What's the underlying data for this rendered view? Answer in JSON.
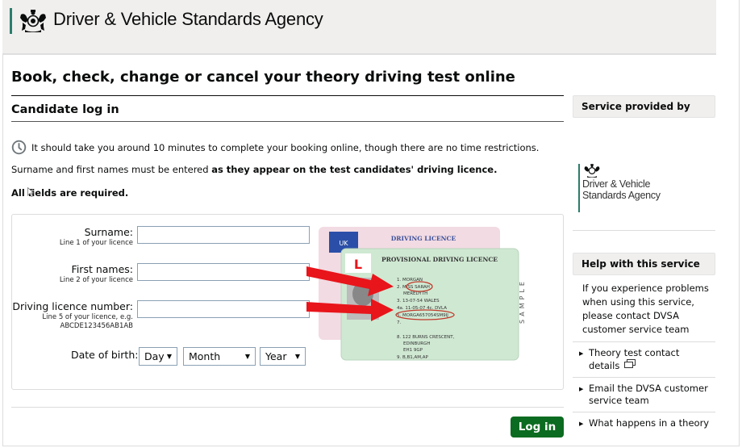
{
  "header": {
    "agency_name": "Driver & Vehicle Standards Agency",
    "brand_color": "#2b7d6a"
  },
  "main": {
    "page_title": "Book, check, change or cancel your theory driving test online",
    "section_title": "Candidate log in",
    "intro_icon": "clock-icon",
    "intro_text": "It should take you around 10 minutes to complete your booking online, though there are no time restrictions.",
    "note_prefix": "Surname and first names must be entered ",
    "note_bold": "as they appear on the test candidates' driving licence.",
    "required_text": "All fields are required."
  },
  "form": {
    "surname": {
      "label": "Surname:",
      "hint": "Line 1 of your licence",
      "value": ""
    },
    "first_names": {
      "label": "First names:",
      "hint": "Line 2 of your licence",
      "value": ""
    },
    "licence_number": {
      "label": "Driving licence number:",
      "hint": "Line 5 of your licence, e.g.",
      "example": "ABCDE123456AB1AB",
      "value": ""
    },
    "dob": {
      "label": "Date of birth:",
      "day": "Day",
      "month": "Month",
      "year": "Year"
    },
    "login_label": "Log in",
    "login_color": "#0b6b20"
  },
  "licence_image": {
    "back_title": "DRIVING LICENCE",
    "front_title": "PROVISIONAL DRIVING LICENCE",
    "country": "UK",
    "learner_badge": "L",
    "lines": [
      "1. MORGAN",
      "2. MISS SARAH",
      "MEREDYTH",
      "3. 13-07-54 WALES",
      "4a. 11-05-07 4c. DVLA",
      "5. MORGA657054SM9IJ",
      "7.",
      "8. 122 BURNS CRESCENT,",
      "EDINBURGH",
      "EH1 9GP",
      "9. B,B1,AM,AP"
    ],
    "watermark": "SAMPLE",
    "arrow_color": "#e8151b"
  },
  "sidebar": {
    "provider_heading": "Service provided by",
    "provider_name": "Driver & Vehicle Standards Agency",
    "help_heading": "Help with this service",
    "help_text": "If you experience problems when using this service, please contact DVSA customer service team",
    "links": [
      {
        "label": "Theory test contact details",
        "external": true
      },
      {
        "label": "Email the DVSA customer service team",
        "external": false
      },
      {
        "label": "What happens in a theory",
        "external": false
      }
    ]
  }
}
